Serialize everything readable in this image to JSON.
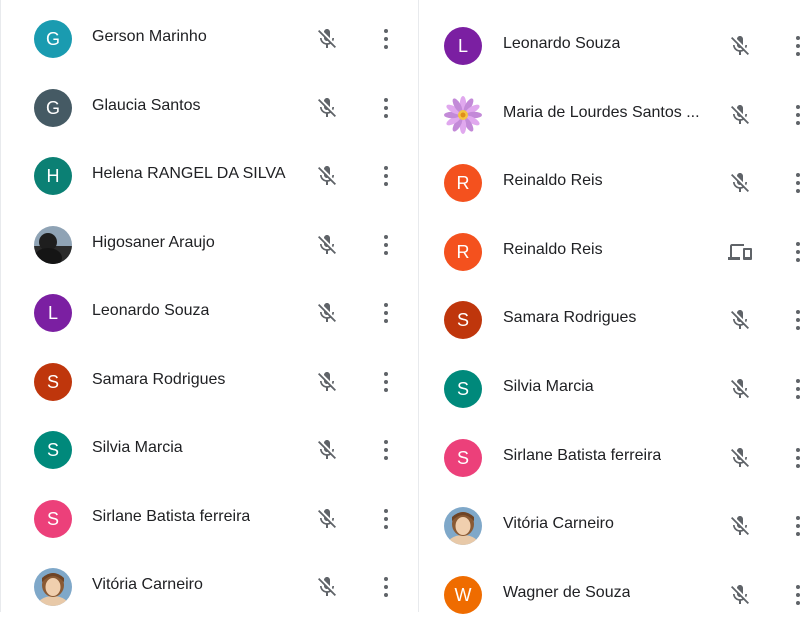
{
  "left_participants": [
    {
      "name": "Gerson Marinho",
      "initial": "G",
      "color": "#1a9bb0",
      "avatar": "initial",
      "status_icon": "mic-off-icon"
    },
    {
      "name": "Glaucia Santos",
      "initial": "G",
      "color": "#455a64",
      "avatar": "initial",
      "status_icon": "mic-off-icon"
    },
    {
      "name": "Helena RANGEL DA SILVA",
      "initial": "H",
      "color": "#0b8074",
      "avatar": "initial",
      "status_icon": "mic-off-icon"
    },
    {
      "name": "Higosaner Araujo",
      "initial": "",
      "color": "#3b3b3b",
      "avatar": "photo-landscape",
      "status_icon": "mic-off-icon"
    },
    {
      "name": "Leonardo Souza",
      "initial": "L",
      "color": "#7b1fa2",
      "avatar": "initial",
      "status_icon": "mic-off-icon"
    },
    {
      "name": "Samara Rodrigues",
      "initial": "S",
      "color": "#bf360c",
      "avatar": "initial",
      "status_icon": "mic-off-icon"
    },
    {
      "name": "Silvia Marcia",
      "initial": "S",
      "color": "#00897b",
      "avatar": "initial",
      "status_icon": "mic-off-icon"
    },
    {
      "name": "Sirlane Batista ferreira",
      "initial": "S",
      "color": "#ec407a",
      "avatar": "initial",
      "status_icon": "mic-off-icon"
    },
    {
      "name": "Vitória Carneiro",
      "initial": "",
      "color": "#c9a27c",
      "avatar": "photo-portrait",
      "status_icon": "mic-off-icon"
    }
  ],
  "right_participants": [
    {
      "name": "Leonardo Souza",
      "initial": "L",
      "color": "#7b1fa2",
      "avatar": "initial",
      "status_icon": "mic-off-icon"
    },
    {
      "name": "Maria de Lourdes Santos ...",
      "initial": "",
      "color": "#9b59b6",
      "avatar": "photo-flower",
      "status_icon": "mic-off-icon"
    },
    {
      "name": "Reinaldo Reis",
      "initial": "R",
      "color": "#f4511e",
      "avatar": "initial",
      "status_icon": "mic-off-icon"
    },
    {
      "name": "Reinaldo Reis",
      "initial": "R",
      "color": "#f4511e",
      "avatar": "initial",
      "status_icon": "companion-device-icon"
    },
    {
      "name": "Samara Rodrigues",
      "initial": "S",
      "color": "#bf360c",
      "avatar": "initial",
      "status_icon": "mic-off-icon"
    },
    {
      "name": "Silvia Marcia",
      "initial": "S",
      "color": "#00897b",
      "avatar": "initial",
      "status_icon": "mic-off-icon"
    },
    {
      "name": "Sirlane Batista ferreira",
      "initial": "S",
      "color": "#ec407a",
      "avatar": "initial",
      "status_icon": "mic-off-icon"
    },
    {
      "name": "Vitória Carneiro",
      "initial": "",
      "color": "#c9a27c",
      "avatar": "photo-portrait",
      "status_icon": "mic-off-icon"
    },
    {
      "name": "Wagner de Souza",
      "initial": "W",
      "color": "#ef6c00",
      "avatar": "initial",
      "status_icon": "mic-off-icon"
    }
  ]
}
